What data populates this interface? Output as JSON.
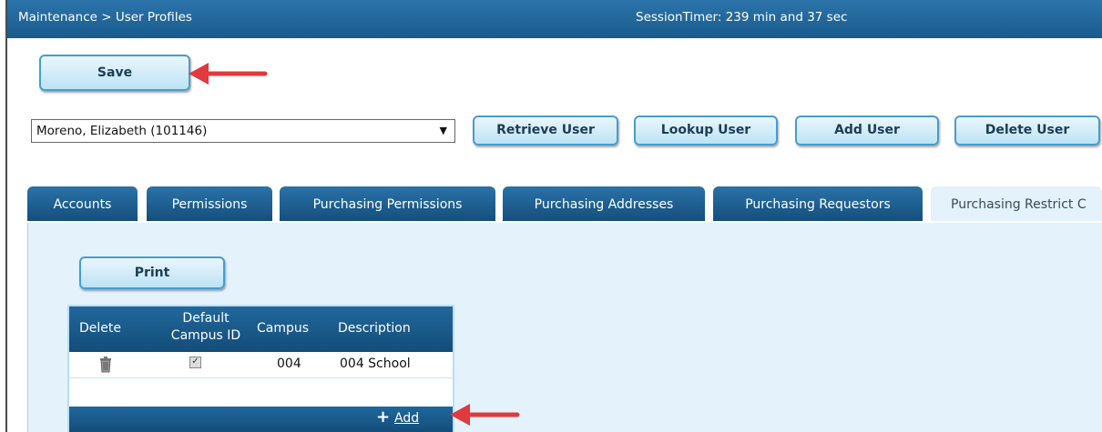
{
  "header": {
    "breadcrumb": "Maintenance > User Profiles",
    "session_timer": "SessionTimer: 239 min and 37 sec"
  },
  "toolbar": {
    "save_label": "Save"
  },
  "user_select": {
    "value": "Moreno, Elizabeth (101146)"
  },
  "user_actions": {
    "retrieve": "Retrieve User",
    "lookup": "Lookup User",
    "add": "Add User",
    "delete": "Delete User"
  },
  "tabs": [
    {
      "label": "Accounts"
    },
    {
      "label": "Permissions"
    },
    {
      "label": "Purchasing Permissions"
    },
    {
      "label": "Purchasing Addresses"
    },
    {
      "label": "Purchasing Requestors"
    },
    {
      "label": "Purchasing Restrict C"
    }
  ],
  "panel": {
    "print_label": "Print",
    "columns": {
      "delete": "Delete",
      "default_line1": "Default",
      "default_line2": "Campus ID",
      "campus": "Campus",
      "description": "Description"
    },
    "rows": [
      {
        "default_checked": true,
        "campus": "004",
        "description": "004 School"
      }
    ],
    "add_label": "Add"
  },
  "colors": {
    "header_blue": "#1a5b8d",
    "panel_bg": "#e3f2fb",
    "annotation_arrow": "#e0393e"
  },
  "icons": {
    "delete": "trash-icon",
    "add": "plus-icon",
    "dropdown": "caret-down-icon"
  }
}
